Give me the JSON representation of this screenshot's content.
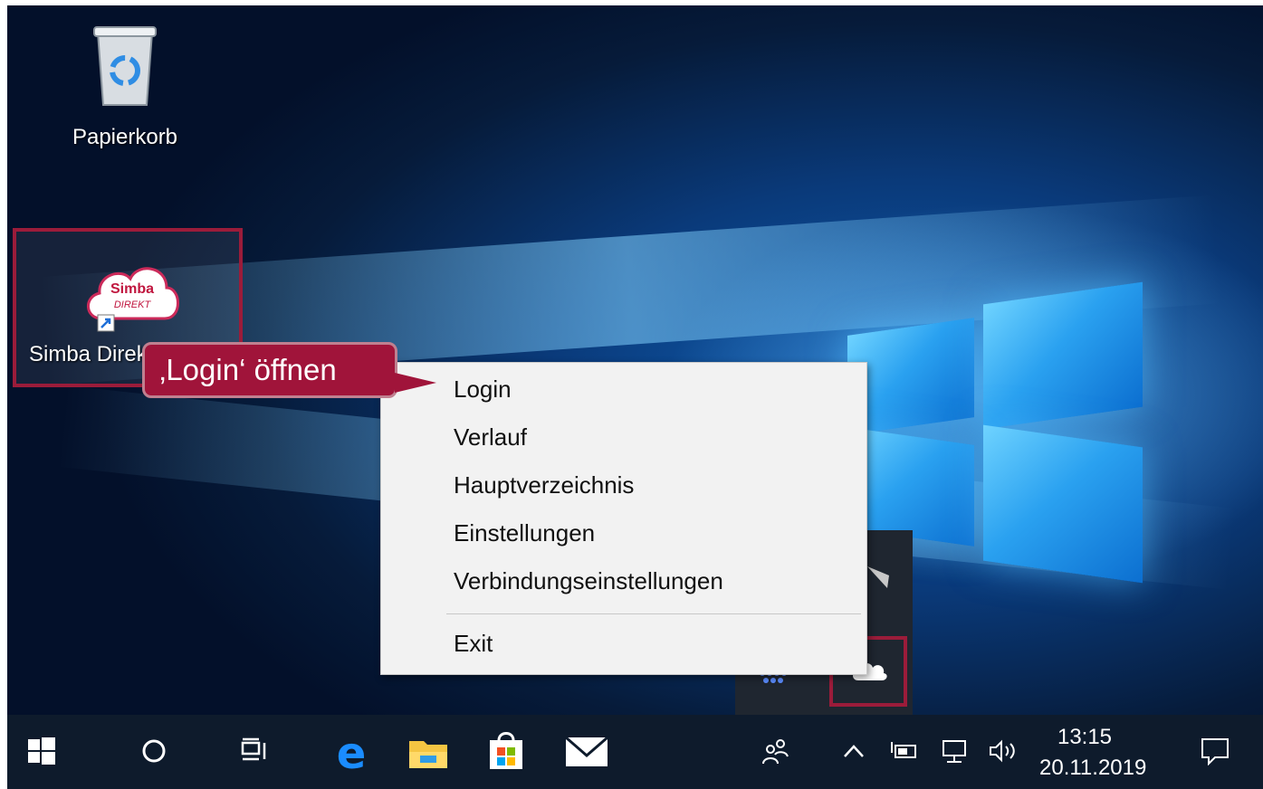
{
  "desktop": {
    "icons": [
      {
        "label": "Papierkorb",
        "icon": "recycle-bin-icon"
      },
      {
        "label": "Simba Direkt Push",
        "icon": "simba-direkt-cloud-icon",
        "logo_text_1": "Simba",
        "logo_text_2": "DIREKT"
      }
    ]
  },
  "callout": {
    "text": "‚Login‘ öffnen",
    "color": "#a0143a"
  },
  "context_menu": {
    "items": [
      "Login",
      "Verlauf",
      "Hauptverzeichnis",
      "Einstellungen",
      "Verbindungseinstellungen"
    ],
    "exit_label": "Exit"
  },
  "highlight_color": "#9b1c3a",
  "taskbar": {
    "icons": [
      "windows-start-icon",
      "cortana-search-icon",
      "task-view-icon",
      "edge-browser-icon",
      "file-explorer-icon",
      "store-icon",
      "mail-icon"
    ],
    "tray_icons": [
      "people-icon",
      "chevron-up-icon",
      "battery-icon",
      "network-icon",
      "volume-icon",
      "action-center-icon"
    ],
    "time": "13:15",
    "date": "20.11.2019"
  }
}
